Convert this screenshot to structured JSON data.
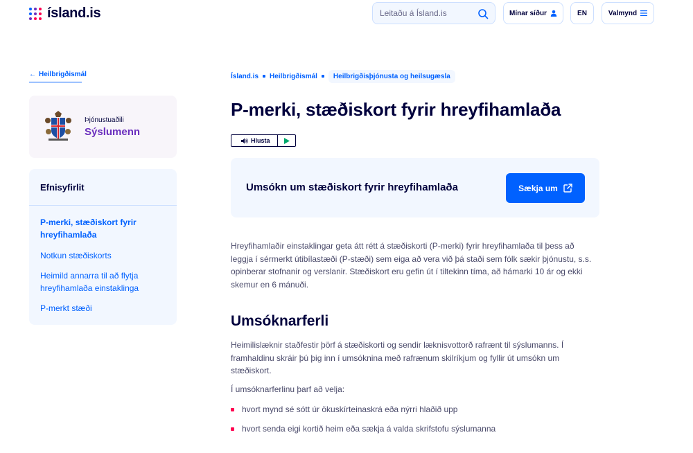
{
  "header": {
    "logo_text": "ísland.is",
    "search_placeholder": "Leitaðu á Ísland.is",
    "my_pages_label": "Mínar síður",
    "lang_label": "EN",
    "menu_label": "Valmynd"
  },
  "sidebar": {
    "back_label": "Heilbrigðismál",
    "agency_label": "Þjónustuaðili",
    "agency_name": "Sýslumenn",
    "toc_title": "Efnisyfirlit",
    "toc_items": [
      {
        "label": "P-merki, stæðiskort fyrir hreyfihamlaða"
      },
      {
        "label": "Notkun stæðiskorts"
      },
      {
        "label": "Heimild annarra til að flytja hreyfihamlaða einstaklinga"
      },
      {
        "label": "P-merkt stæði"
      }
    ]
  },
  "breadcrumb": [
    "Ísland.is",
    "Heilbrigðismál",
    "Heilbrigðisþjónusta og heilsugæsla"
  ],
  "main": {
    "title": "P-merki, stæðiskort fyrir hreyfihamlaða",
    "listen_label": "Hlusta",
    "apply_title": "Umsókn um stæðiskort fyrir hreyfihamlaða",
    "apply_button": "Sækja um",
    "intro": "Hreyfihamlaðir einstaklingar geta átt rétt á stæðiskorti (P-merki) fyrir hreyfihamlaða til þess að leggja í sérmerkt útibílastæði (P-stæði) sem eiga að vera við þá staði sem fólk sækir þjónustu, s.s. opinberar stofnanir og verslanir. Stæðiskort eru gefin út í tiltekinn tíma, að hámarki 10 ár og ekki skemur en 6 mánuði.",
    "section_title": "Umsóknarferli",
    "process_text": "Heimilislæknir staðfestir þörf á stæðiskorti og sendir læknisvottorð rafrænt til sýslumanns. Í framhaldinu skráir þú þig inn í umsóknina með rafrænum skilríkjum og fyllir út umsókn um stæðiskort.",
    "choose_text": "Í umsóknarferlinu þarf að velja:",
    "bullets": [
      "hvort mynd sé sótt úr ökuskírteinaskrá eða nýrri hlaðið upp",
      "hvort senda eigi kortið heim eða sækja á valda skrifstofu sýslumanna"
    ]
  },
  "colors": {
    "primary": "#0061ff",
    "dark": "#00003c",
    "accent_red": "#ff0050",
    "purple": "#6a2ebd",
    "light_blue": "#f2f7ff"
  }
}
